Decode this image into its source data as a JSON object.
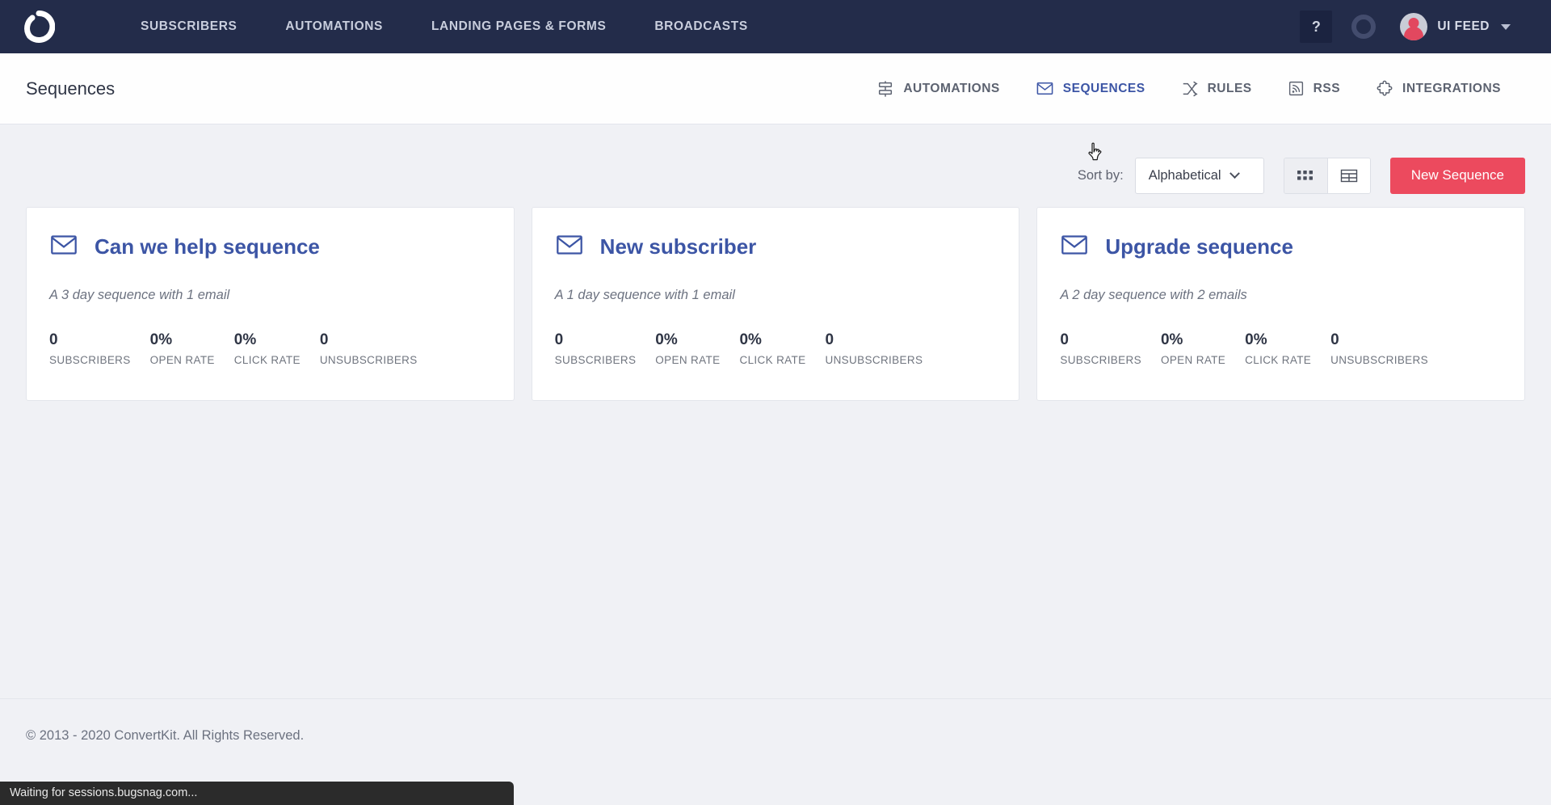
{
  "topbar": {
    "logo_name": "convertkit-logo",
    "nav_items": [
      {
        "label": "SUBSCRIBERS",
        "name": "nav-subscribers"
      },
      {
        "label": "AUTOMATIONS",
        "name": "nav-automations"
      },
      {
        "label": "LANDING PAGES & FORMS",
        "name": "nav-landing-pages-forms"
      },
      {
        "label": "BROADCASTS",
        "name": "nav-broadcasts"
      }
    ],
    "help_label": "?",
    "account_name": "UI FEED",
    "brand_dark": "#232c4a"
  },
  "subheader": {
    "page_title": "Sequences",
    "items": [
      {
        "label": "AUTOMATIONS",
        "icon": "flowchart-icon",
        "active": false
      },
      {
        "label": "SEQUENCES",
        "icon": "envelope-icon",
        "active": true
      },
      {
        "label": "RULES",
        "icon": "shuffle-icon",
        "active": false
      },
      {
        "label": "RSS",
        "icon": "rss-icon",
        "active": false
      },
      {
        "label": "INTEGRATIONS",
        "icon": "puzzle-icon",
        "active": false
      }
    ],
    "active_color": "#3c55a5"
  },
  "toolbar": {
    "sort_label": "Sort by:",
    "sort_value": "Alphabetical",
    "sort_options": [
      "Alphabetical"
    ],
    "grid_view_name": "grid-view",
    "table_view_name": "table-view",
    "selected_view": "grid",
    "new_button_label": "New Sequence",
    "accent_color": "#ec4a5e"
  },
  "stat_labels": {
    "subscribers": "SUBSCRIBERS",
    "open_rate": "OPEN RATE",
    "click_rate": "CLICK RATE",
    "unsubscribers": "UNSUBSCRIBERS"
  },
  "sequences": [
    {
      "title": "Can we help sequence",
      "description": "A 3 day sequence with 1 email",
      "subscribers": "0",
      "open_rate": "0%",
      "click_rate": "0%",
      "unsubscribers": "0"
    },
    {
      "title": "New subscriber",
      "description": "A 1 day sequence with 1 email",
      "subscribers": "0",
      "open_rate": "0%",
      "click_rate": "0%",
      "unsubscribers": "0"
    },
    {
      "title": "Upgrade sequence",
      "description": "A 2 day sequence with 2 emails",
      "subscribers": "0",
      "open_rate": "0%",
      "click_rate": "0%",
      "unsubscribers": "0"
    }
  ],
  "footer": {
    "copyright": "© 2013 - 2020 ConvertKit. All Rights Reserved."
  },
  "browser_status": {
    "text": "Waiting for sessions.bugsnag.com..."
  }
}
